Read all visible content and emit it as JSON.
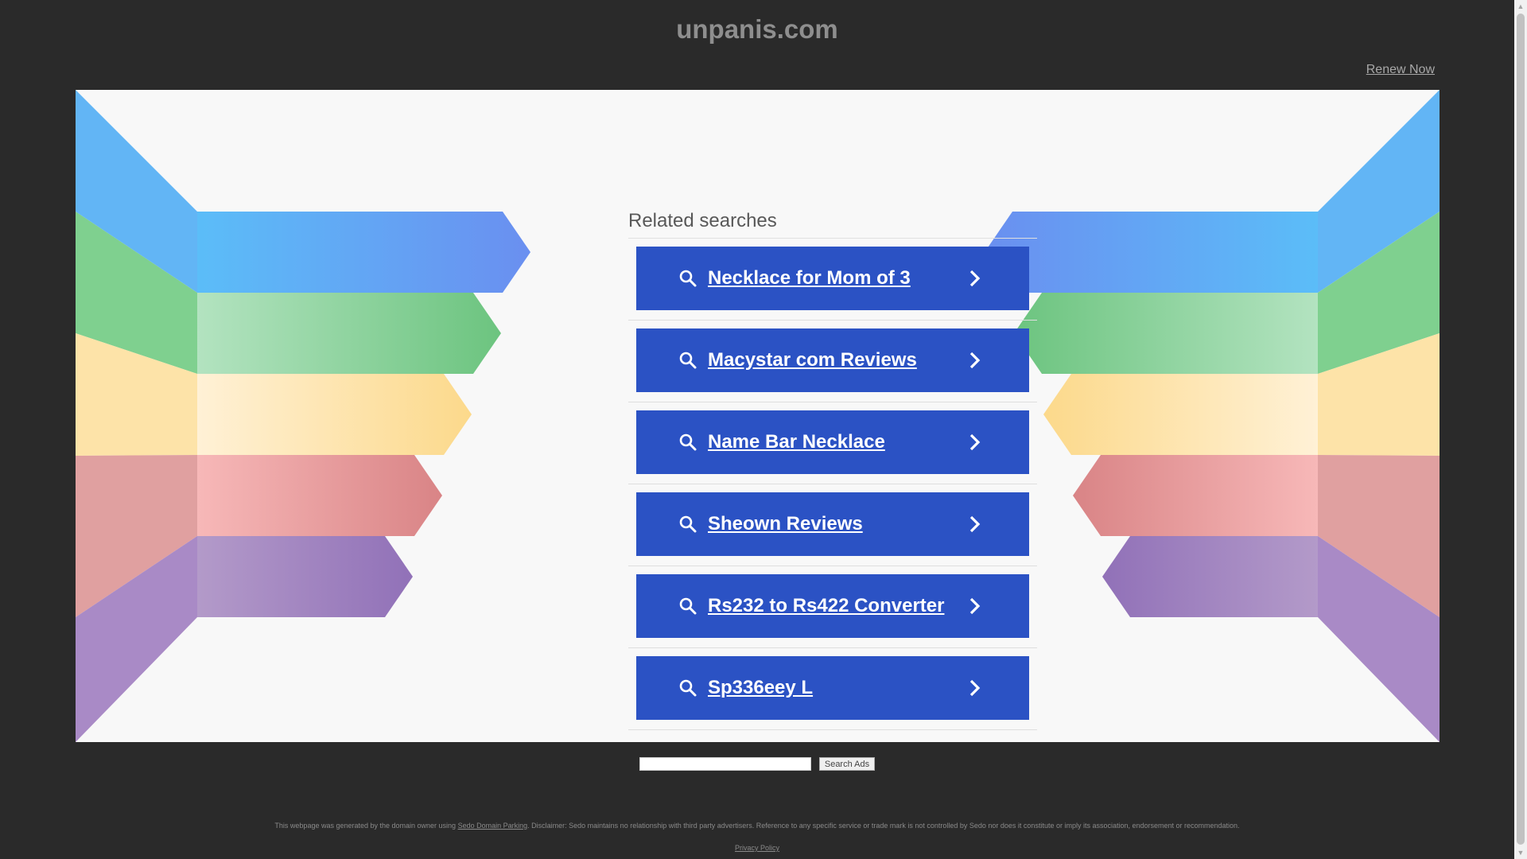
{
  "header": {
    "domain_title": "unpanis.com",
    "renew_label": "Renew Now"
  },
  "related": {
    "title": "Related searches",
    "items": [
      {
        "label": "Necklace for Mom of 3"
      },
      {
        "label": "Macystar com Reviews"
      },
      {
        "label": "Name Bar Necklace"
      },
      {
        "label": "Sheown Reviews"
      },
      {
        "label": "Rs232 to Rs422 Converter"
      },
      {
        "label": "Sp336eey L"
      }
    ]
  },
  "search": {
    "input_value": "",
    "button_label": "Search Ads"
  },
  "footer": {
    "disclaimer_before": "This webpage was generated by the domain owner using ",
    "disclaimer_link": "Sedo Domain Parking",
    "disclaimer_after": ". Disclaimer: Sedo maintains no relationship with third party advertisers. Reference to any specific service or trade mark is not controlled by Sedo nor does it constitute or imply its association, endorsement or recommendation.",
    "privacy_label": "Privacy Policy"
  },
  "colors": {
    "page_bg": "#2a2a2a",
    "panel_bg": "#f8f8f8",
    "button_blue": "#2b52c4"
  }
}
